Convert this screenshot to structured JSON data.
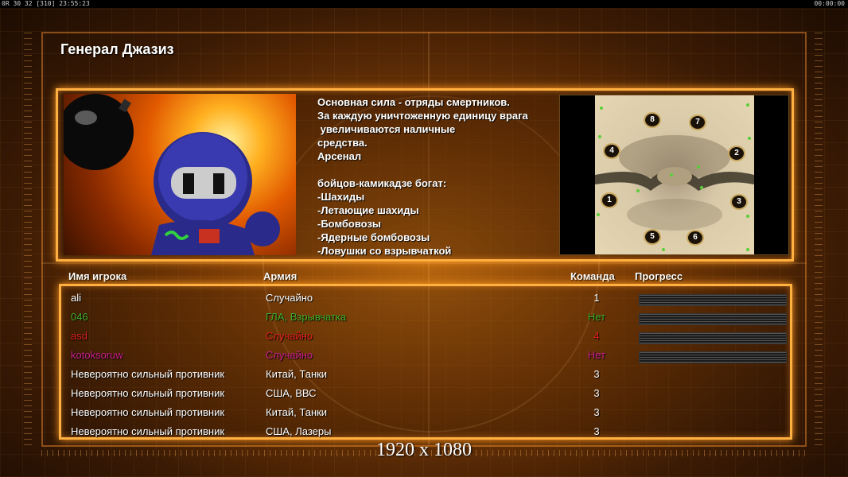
{
  "topbar": {
    "left": "0R 30 32 [310] 23:55:23",
    "right": "00:00:00"
  },
  "general_title": "Генерал Джазиз",
  "description": "Основная сила - отряды смертников.\nЗа каждую уничтоженную единицу врага\n увеличиваются наличные\nсредства.\nАрсенал\n\nбойцов-камикадзе богат:\n-Шахиды\n-Летающие шахиды\n-Бомбовозы\n-Ядерные бомбовозы\n-Ловушки со взрывчаткой",
  "map": {
    "spawns": [
      "8",
      "7",
      "4",
      "2",
      "1",
      "3",
      "5",
      "6"
    ]
  },
  "headers": {
    "player": "Имя игрока",
    "army": "Армия",
    "team": "Команда",
    "progress": "Прогресс"
  },
  "players": [
    {
      "name": "ali",
      "army": "Случайно",
      "team": "1",
      "color": "#ffffff",
      "progress_bar": true
    },
    {
      "name": "046",
      "army": "ГЛА, Взрывчатка",
      "team": "Нет",
      "color": "#3fae2a",
      "progress_bar": true
    },
    {
      "name": "asd",
      "army": "Случайно",
      "team": "4",
      "color": "#e0201a",
      "progress_bar": true
    },
    {
      "name": "kotoksoruw",
      "army": "Случайно",
      "team": "Нет",
      "color": "#c8208a",
      "progress_bar": true
    },
    {
      "name": "Невероятно сильный противник",
      "army": "Китай, Танки",
      "team": "3",
      "color": "#ffffff",
      "progress_bar": false
    },
    {
      "name": "Невероятно сильный противник",
      "army": "США, ВВС",
      "team": "3",
      "color": "#ffffff",
      "progress_bar": false
    },
    {
      "name": "Невероятно сильный противник",
      "army": "Китай, Танки",
      "team": "3",
      "color": "#ffffff",
      "progress_bar": false
    },
    {
      "name": "Невероятно сильный противник",
      "army": "США, Лазеры",
      "team": "3",
      "color": "#ffffff",
      "progress_bar": false
    }
  ],
  "resolution_label": "1920 x 1080"
}
